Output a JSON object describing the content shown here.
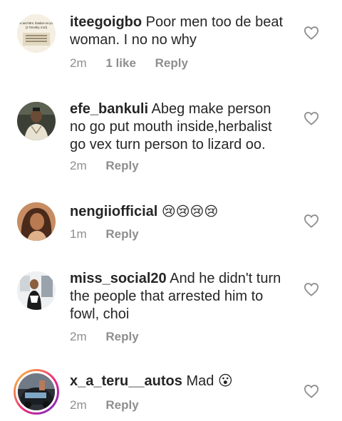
{
  "comments": [
    {
      "username": "iteegoigbo",
      "text": "Poor men too de beat woman.  I no no why",
      "time": "2m",
      "likes": "1 like",
      "reply": "Reply",
      "avatar_caption_1": "Mr.and Mrs. Ibadan-on-you",
      "avatar_caption_2": "(2 Timothy 4:10)"
    },
    {
      "username": "efe_bankuli",
      "text": "Abeg make person no go put mouth inside,herbalist go vex turn person to lizard oo.",
      "time": "2m",
      "reply": "Reply"
    },
    {
      "username": "nengiiofficial",
      "text": "😢😢😢😢",
      "time": "1m",
      "reply": "Reply"
    },
    {
      "username": "miss_social20",
      "text": "And he didn't turn the people that arrested him to fowl, choi",
      "time": "2m",
      "reply": "Reply"
    },
    {
      "username": "x_a_teru__autos",
      "text": "Mad 😮",
      "time": "2m",
      "reply": "Reply"
    }
  ],
  "icons": {
    "heart": "heart-outline-icon"
  },
  "colors": {
    "text": "#262626",
    "muted": "#8e8e8e",
    "story_ring_start": "#f9ce34",
    "story_ring_end": "#6228d7"
  }
}
